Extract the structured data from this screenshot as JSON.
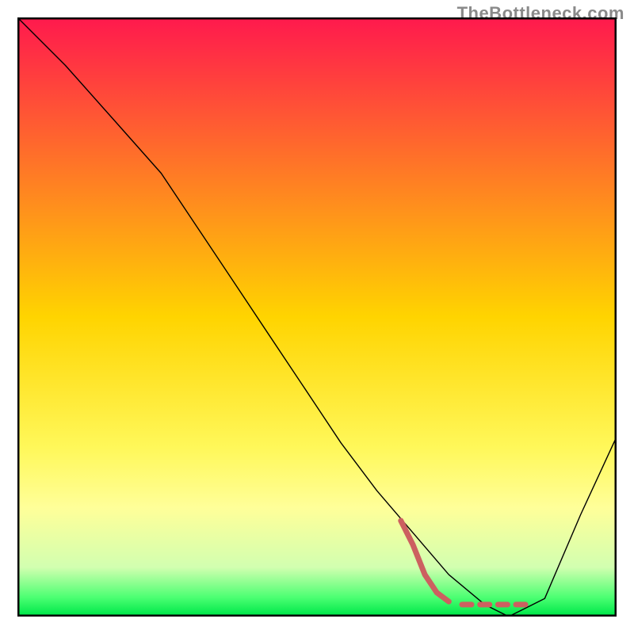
{
  "watermark": "TheBottleneck.com",
  "chart_data": {
    "type": "line",
    "title": "",
    "xlabel": "",
    "ylabel": "",
    "xlim": [
      0,
      100
    ],
    "ylim": [
      0,
      100
    ],
    "grid": false,
    "legend": false,
    "background_gradient": {
      "stops": [
        {
          "pos": 0.0,
          "color": "#ff1a4d"
        },
        {
          "pos": 0.5,
          "color": "#ffd400"
        },
        {
          "pos": 0.72,
          "color": "#fff85a"
        },
        {
          "pos": 0.82,
          "color": "#ffff99"
        },
        {
          "pos": 0.92,
          "color": "#d2ffb0"
        },
        {
          "pos": 0.97,
          "color": "#4dff73"
        },
        {
          "pos": 1.0,
          "color": "#00e84a"
        }
      ]
    },
    "series": [
      {
        "name": "bottleneck-curve",
        "stroke": "#000000",
        "stroke_width": 1.4,
        "x": [
          0,
          8,
          16,
          24,
          30,
          36,
          42,
          48,
          54,
          60,
          66,
          72,
          78,
          82,
          88,
          94,
          100
        ],
        "y": [
          100,
          92,
          83,
          74,
          65,
          56,
          47,
          38,
          29,
          21,
          14,
          7,
          2,
          0,
          3,
          17,
          30
        ]
      }
    ],
    "marker_segment": {
      "name": "highlight-dashes",
      "stroke": "#cc6060",
      "stroke_width": 7,
      "points": [
        {
          "x": 64,
          "y": 16
        },
        {
          "x": 66,
          "y": 12
        },
        {
          "x": 68,
          "y": 7
        },
        {
          "x": 70,
          "y": 4
        },
        {
          "x": 72,
          "y": 2.5
        },
        {
          "x": 75,
          "y": 2
        },
        {
          "x": 78,
          "y": 2
        },
        {
          "x": 81,
          "y": 2
        },
        {
          "x": 84,
          "y": 2
        }
      ]
    }
  }
}
